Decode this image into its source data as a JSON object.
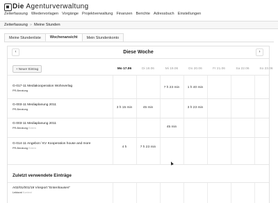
{
  "app": {
    "title_bold": "Die",
    "title_rest": " Agenturverwaltung"
  },
  "menu": [
    "Zeiterfassung",
    "Wiedervorlagen",
    "Vorgänge",
    "Projektverwaltung",
    "Finanzen",
    "Berichte",
    "Adressbuch",
    "Einstellungen"
  ],
  "breadcrumb": {
    "root": "Zeiterfassung",
    "sep": "»",
    "current": "Meine Stunden"
  },
  "tabs": [
    "Meine Stundenliste",
    "Wochenansicht",
    "Mein Stundenkonto"
  ],
  "week": {
    "prev": "‹",
    "next": "›",
    "title": "Diese Woche"
  },
  "add_button": "+ Neuer Eintrag",
  "days": [
    "Mo 17.06",
    "Di 18.06",
    "Mi 19.06",
    "Do 20.06",
    "Fr 21.06",
    "Sa 22.06",
    "So 23.06"
  ],
  "entries": [
    {
      "title": "G-017-11 Mediakooperation Wohnverlag",
      "sub": "PR-Beratung",
      "sub_muted": "",
      "hours": [
        "",
        "",
        "7 h 23 min",
        "1 h 40 min",
        "",
        "",
        ""
      ]
    },
    {
      "title": "G-003-11 Mediaplanung 2011",
      "sub": "PR-Beratung",
      "sub_muted": "",
      "hours": [
        "3 h 15 min",
        "45 min",
        "",
        "3 h 23 min",
        "",
        "",
        ""
      ]
    },
    {
      "title": "G-003-11 Mediaplanung 2011",
      "sub": "PR-Beratung",
      "sub_muted": " Extern",
      "hours": [
        "",
        "",
        "45 min",
        "",
        "",
        "",
        ""
      ]
    },
    {
      "title": "G-014-11 Angebot / KV Kooperation house and more",
      "sub": "PR-Beratung",
      "sub_muted": " Extern",
      "hours": [
        "4 h",
        "7 h 23 min",
        "",
        "",
        "",
        "",
        ""
      ]
    }
  ],
  "recent": {
    "title": "Zuletzt verwendete Einträge",
    "items": [
      {
        "title": "A02/01/001/19 Vinsport \"Entenhausen\"",
        "sub": "Lektorat",
        "sub_muted": " Kontext"
      }
    ]
  }
}
